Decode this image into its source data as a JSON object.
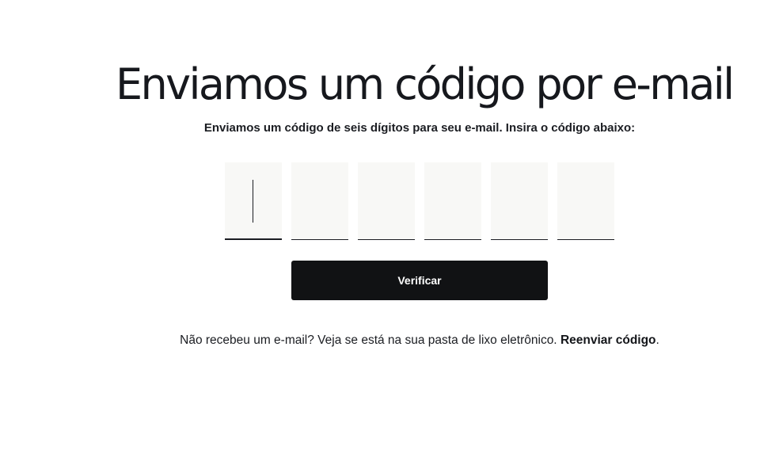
{
  "page": {
    "title": "Enviamos um código por e-mail",
    "subtitle": "Enviamos um código de seis dígitos para seu e-mail. Insira o código abaixo:"
  },
  "code_inputs": {
    "digits": [
      "",
      "",
      "",
      "",
      "",
      ""
    ],
    "active_index": 0
  },
  "verify_button": {
    "label": "Verificar"
  },
  "footer": {
    "note": "Não recebeu um e-mail? Veja se está na sua pasta de lixo eletrônico.",
    "resend_label": "Reenviar código",
    "period": "."
  }
}
